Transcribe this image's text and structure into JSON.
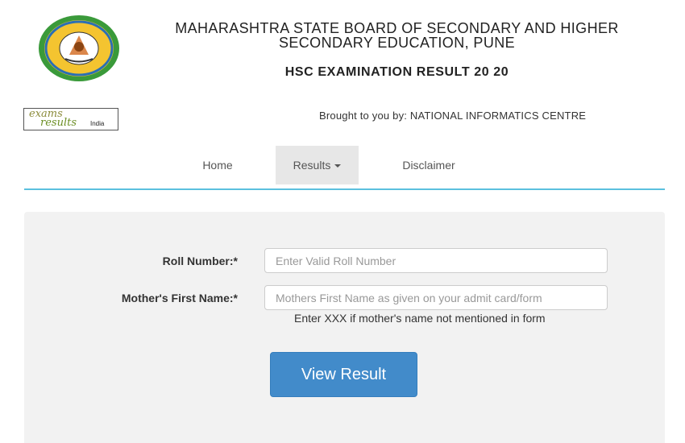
{
  "header": {
    "board_line1": "MAHARASHTRA STATE BOARD OF SECONDARY AND HIGHER",
    "board_line2": "SECONDARY EDUCATION, PUNE",
    "exam_title": "HSC EXAMINATION RESULT 20 20"
  },
  "partner": {
    "logo_word1": "exams",
    "logo_word2": "results",
    "logo_word3": "India",
    "credit_text": "Brought to you by: NATIONAL INFORMATICS CENTRE"
  },
  "nav": {
    "home": "Home",
    "results": "Results",
    "disclaimer": "Disclaimer"
  },
  "form": {
    "roll_label": "Roll Number:*",
    "roll_placeholder": "Enter Valid Roll Number",
    "roll_value": "",
    "mother_label": "Mother's First Name:*",
    "mother_placeholder": "Mothers First Name as given on your admit card/form",
    "mother_value": "",
    "mother_hint": "Enter XXX if mother's name not mentioned in form",
    "submit_label": "View Result"
  },
  "colors": {
    "accent_line": "#5bc0de",
    "button": "#428bca",
    "panel": "#f2f2f2",
    "nav_active": "#e7e7e7"
  },
  "icons": {
    "board_seal": "maharashtra-board-seal-icon",
    "dropdown": "caret-down-icon"
  }
}
